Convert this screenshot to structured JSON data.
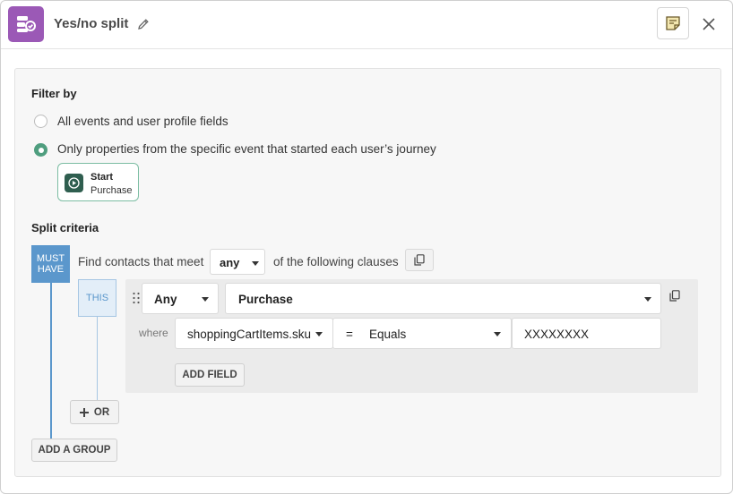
{
  "header": {
    "title": "Yes/no split",
    "icons": {
      "app": "split-icon",
      "edit": "pencil-icon",
      "notes": "notes-icon",
      "close": "close-icon"
    }
  },
  "filter": {
    "heading": "Filter by",
    "options": [
      {
        "label": "All events and user profile fields",
        "selected": false
      },
      {
        "label": "Only properties from the specific event that started each user’s journey",
        "selected": true
      }
    ],
    "start_card": {
      "title": "Start",
      "subtitle": "Purchase"
    }
  },
  "split": {
    "heading": "Split criteria",
    "must_have_label": "MUST HAVE",
    "find_prefix": "Find contacts that meet",
    "match_value": "any",
    "find_suffix": "of the following clauses",
    "this_label": "THIS",
    "clause": {
      "event_qualifier": "Any",
      "event_name": "Purchase",
      "where_label": "where",
      "field": "shoppingCartItems.sku",
      "operator_symbol": "=",
      "operator": "Equals",
      "value": "XXXXXXXX",
      "add_field_label": "ADD FIELD"
    },
    "or_label": "OR",
    "add_group_label": "ADD A GROUP"
  },
  "colors": {
    "brand": "#9b59b6",
    "radio_on": "#4f9e7f",
    "must_have": "#5b97cc",
    "start_icon": "#2f5e4f"
  }
}
